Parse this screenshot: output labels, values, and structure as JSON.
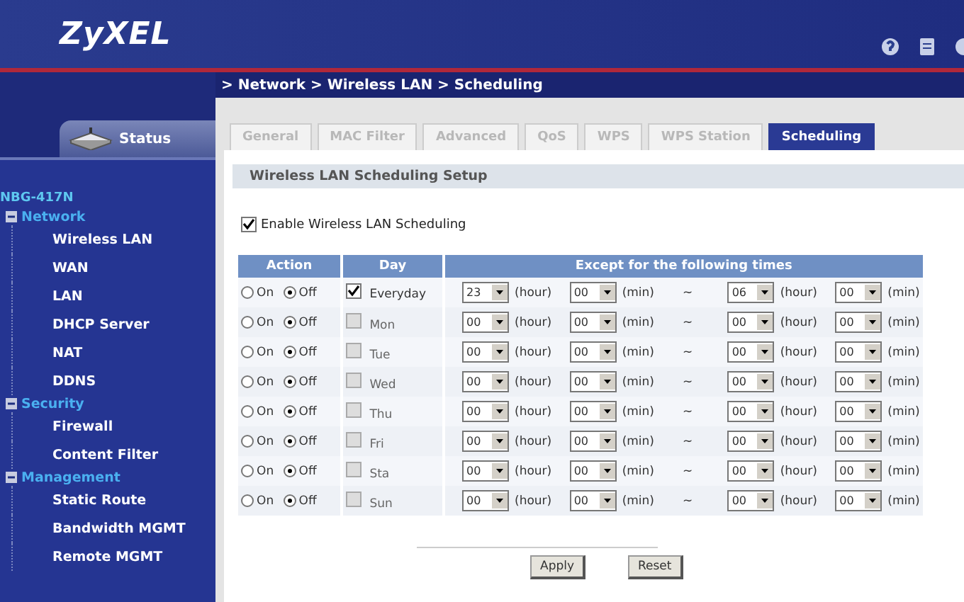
{
  "header": {
    "logo": "ZyXEL"
  },
  "breadcrumb": "> Network > Wireless LAN > Scheduling",
  "status_tab": {
    "label": "Status"
  },
  "sidebar": {
    "device": "NBG-417N",
    "groups": [
      {
        "label": "Network",
        "expanded": true,
        "children": [
          {
            "label": "Wireless LAN"
          },
          {
            "label": "WAN"
          },
          {
            "label": "LAN"
          },
          {
            "label": "DHCP Server"
          },
          {
            "label": "NAT"
          },
          {
            "label": "DDNS"
          }
        ]
      },
      {
        "label": "Security",
        "expanded": true,
        "children": [
          {
            "label": "Firewall"
          },
          {
            "label": "Content Filter"
          }
        ]
      },
      {
        "label": "Management",
        "expanded": true,
        "children": [
          {
            "label": "Static Route"
          },
          {
            "label": "Bandwidth MGMT"
          },
          {
            "label": "Remote MGMT"
          }
        ]
      }
    ]
  },
  "tabs": [
    {
      "label": "General",
      "selected": false
    },
    {
      "label": "MAC Filter",
      "selected": false
    },
    {
      "label": "Advanced",
      "selected": false
    },
    {
      "label": "QoS",
      "selected": false
    },
    {
      "label": "WPS",
      "selected": false
    },
    {
      "label": "WPS Station",
      "selected": false
    },
    {
      "label": "Scheduling",
      "selected": true
    }
  ],
  "section_title": "Wireless LAN Scheduling Setup",
  "enable": {
    "label": "Enable Wireless LAN Scheduling",
    "checked": true
  },
  "table": {
    "columns": [
      "Action",
      "Day",
      "Except for the following times"
    ],
    "rows": [
      {
        "on_label": "On",
        "off_label": "Off",
        "on": false,
        "day": "Everyday",
        "checked": true,
        "separator": "~",
        "times": [
          {
            "value": "23",
            "unit": "(hour)"
          },
          {
            "value": "00",
            "unit": "(min)"
          },
          {
            "value": "06",
            "unit": "(hour)"
          },
          {
            "value": "00",
            "unit": "(min)"
          }
        ]
      },
      {
        "on_label": "On",
        "off_label": "Off",
        "on": false,
        "day": "Mon",
        "checked": false,
        "separator": "~",
        "times": [
          {
            "value": "00",
            "unit": "(hour)"
          },
          {
            "value": "00",
            "unit": "(min)"
          },
          {
            "value": "00",
            "unit": "(hour)"
          },
          {
            "value": "00",
            "unit": "(min)"
          }
        ]
      },
      {
        "on_label": "On",
        "off_label": "Off",
        "on": false,
        "day": "Tue",
        "checked": false,
        "separator": "~",
        "times": [
          {
            "value": "00",
            "unit": "(hour)"
          },
          {
            "value": "00",
            "unit": "(min)"
          },
          {
            "value": "00",
            "unit": "(hour)"
          },
          {
            "value": "00",
            "unit": "(min)"
          }
        ]
      },
      {
        "on_label": "On",
        "off_label": "Off",
        "on": false,
        "day": "Wed",
        "checked": false,
        "separator": "~",
        "times": [
          {
            "value": "00",
            "unit": "(hour)"
          },
          {
            "value": "00",
            "unit": "(min)"
          },
          {
            "value": "00",
            "unit": "(hour)"
          },
          {
            "value": "00",
            "unit": "(min)"
          }
        ]
      },
      {
        "on_label": "On",
        "off_label": "Off",
        "on": false,
        "day": "Thu",
        "checked": false,
        "separator": "~",
        "times": [
          {
            "value": "00",
            "unit": "(hour)"
          },
          {
            "value": "00",
            "unit": "(min)"
          },
          {
            "value": "00",
            "unit": "(hour)"
          },
          {
            "value": "00",
            "unit": "(min)"
          }
        ]
      },
      {
        "on_label": "On",
        "off_label": "Off",
        "on": false,
        "day": "Fri",
        "checked": false,
        "separator": "~",
        "times": [
          {
            "value": "00",
            "unit": "(hour)"
          },
          {
            "value": "00",
            "unit": "(min)"
          },
          {
            "value": "00",
            "unit": "(hour)"
          },
          {
            "value": "00",
            "unit": "(min)"
          }
        ]
      },
      {
        "on_label": "On",
        "off_label": "Off",
        "on": false,
        "day": "Sta",
        "checked": false,
        "separator": "~",
        "times": [
          {
            "value": "00",
            "unit": "(hour)"
          },
          {
            "value": "00",
            "unit": "(min)"
          },
          {
            "value": "00",
            "unit": "(hour)"
          },
          {
            "value": "00",
            "unit": "(min)"
          }
        ]
      },
      {
        "on_label": "On",
        "off_label": "Off",
        "on": false,
        "day": "Sun",
        "checked": false,
        "separator": "~",
        "times": [
          {
            "value": "00",
            "unit": "(hour)"
          },
          {
            "value": "00",
            "unit": "(min)"
          },
          {
            "value": "00",
            "unit": "(hour)"
          },
          {
            "value": "00",
            "unit": "(min)"
          }
        ]
      }
    ]
  },
  "buttons": [
    "Apply",
    "Reset"
  ]
}
